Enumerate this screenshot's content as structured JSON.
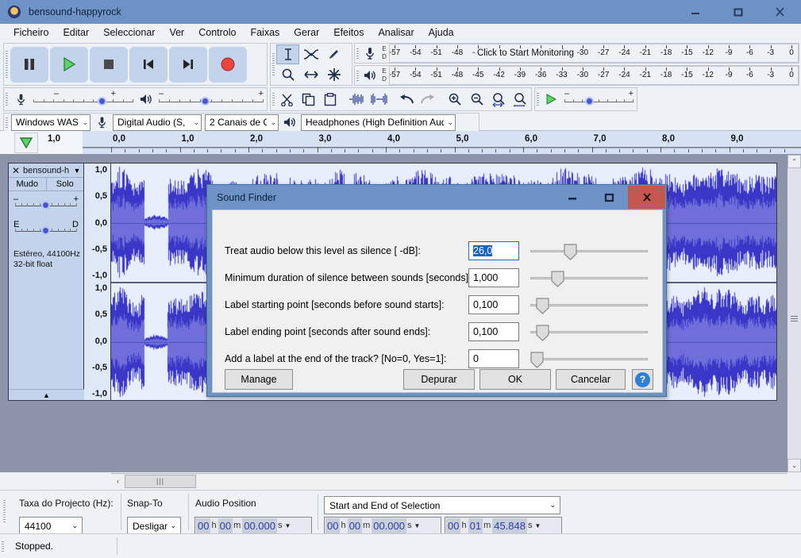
{
  "window": {
    "title": "bensound-happyrock",
    "icon": "audacity-logo-icon",
    "minimize": "–",
    "maximize": "▢",
    "close": "✕"
  },
  "menu": [
    "Ficheiro",
    "Editar",
    "Seleccionar",
    "Ver",
    "Controlo",
    "Faixas",
    "Gerar",
    "Efeitos",
    "Analisar",
    "Ajuda"
  ],
  "transport": [
    {
      "name": "pause-button",
      "icon": "pause-icon"
    },
    {
      "name": "play-button",
      "icon": "play-icon"
    },
    {
      "name": "stop-button",
      "icon": "stop-icon"
    },
    {
      "name": "skip-to-start-button",
      "icon": "skip-start-icon"
    },
    {
      "name": "skip-to-end-button",
      "icon": "skip-end-icon"
    },
    {
      "name": "record-button",
      "icon": "record-icon"
    }
  ],
  "tools": [
    {
      "name": "selection-tool",
      "icon": "i-beam-icon",
      "selected": true
    },
    {
      "name": "envelope-tool",
      "icon": "envelope-icon",
      "selected": false
    },
    {
      "name": "draw-tool",
      "icon": "pencil-icon",
      "selected": false
    },
    {
      "name": "zoom-tool",
      "icon": "magnifier-icon",
      "selected": false
    },
    {
      "name": "timeshift-tool",
      "icon": "arrows-horizontal-icon",
      "selected": false
    },
    {
      "name": "multi-tool",
      "icon": "asterisk-icon",
      "selected": false
    }
  ],
  "meters": {
    "record_hint": "Click to Start Monitoring",
    "ticks": [
      "-57",
      "-54",
      "-51",
      "-48",
      "-45",
      "-42",
      "-39",
      "-36",
      "-33",
      "-30",
      "-27",
      "-24",
      "-21",
      "-18",
      "-15",
      "-12",
      "-9",
      "-6",
      "-3",
      "0"
    ],
    "ed_top": "E",
    "ed_bottom": "D"
  },
  "mixer": {
    "mic_icon": "microphone-icon",
    "speaker_icon": "speaker-icon",
    "minus": "–",
    "plus": "+"
  },
  "edit_toolbar": [
    {
      "name": "cut-button",
      "icon": "scissors-icon"
    },
    {
      "name": "copy-button",
      "icon": "copy-icon"
    },
    {
      "name": "paste-button",
      "icon": "clipboard-icon"
    },
    {
      "name": "trim-audio-button",
      "icon": "trim-outside-icon"
    },
    {
      "name": "silence-audio-button",
      "icon": "silence-selection-icon"
    },
    {
      "name": "undo-button",
      "icon": "undo-arrow-icon"
    },
    {
      "name": "redo-button",
      "icon": "redo-arrow-icon"
    },
    {
      "name": "zoom-in-button",
      "icon": "zoom-in-icon"
    },
    {
      "name": "zoom-out-button",
      "icon": "zoom-out-icon"
    },
    {
      "name": "fit-selection-button",
      "icon": "fit-selection-icon"
    },
    {
      "name": "fit-project-button",
      "icon": "fit-project-icon"
    }
  ],
  "devices": {
    "host": "Windows WAS",
    "recording_device": "Digital Audio (S,",
    "channels": "2 Canais de Gra",
    "playback_device": "Headphones (High Definition Audic",
    "arrow": "⌄"
  },
  "ruler": {
    "pin_icon": "pinned-play-head-icon",
    "left_label": "1,0",
    "labels": [
      "0,0",
      "1,0",
      "2,0",
      "3,0",
      "4,0",
      "5,0",
      "6,0",
      "7,0",
      "8,0",
      "9,0"
    ]
  },
  "track": {
    "close": "✕",
    "name": "bensound-h",
    "dropdown_arrow": "▼",
    "mute": "Mudo",
    "solo": "Solo",
    "gain_minus": "–",
    "gain_plus": "+",
    "pan_left": "E",
    "pan_right": "D",
    "info_line1": "Estéreo, 44100Hz",
    "info_line2": "32-bit float",
    "collapse_icon": "▲",
    "vertical_scale": [
      "1,0",
      "0,5",
      "0,0",
      "-0,5",
      "-1,0"
    ],
    "waveform_peak_color": "#3a37c8",
    "waveform_rms_color": "#6f6edb",
    "waveform_bg_color": "#e8eefb"
  },
  "scrollbars": {
    "up_arrow": "⌃",
    "down_arrow": "⌄",
    "left_arrow": "‹",
    "right_arrow": "›",
    "thumb_grip": "|||"
  },
  "selection_bar": {
    "project_rate_label": "Taxa do Projecto (Hz):",
    "project_rate_value": "44100",
    "snapto_label": "Snap-To",
    "snapto_value": "Desligar",
    "audio_position_label": "Audio Position",
    "selection_mode": "Start and End of Selection",
    "audio_position_time": "00h00m00.000s",
    "selection_start_time": "00h00m00.000s",
    "selection_end_time": "00h01m45.848s",
    "arrow": "⌄"
  },
  "status": {
    "message": "Stopped."
  },
  "dialog": {
    "title": "Sound Finder",
    "minimize": "–",
    "maximize": "▢",
    "close": "✕",
    "fields": [
      {
        "label": "Treat audio below this level as silence [ -dB]:",
        "value": "26,0",
        "selected": true,
        "slider_pct": 32
      },
      {
        "label": "Minimum duration of silence between sounds [seconds]:",
        "value": "1,000",
        "selected": false,
        "slider_pct": 20
      },
      {
        "label": "Label starting point [seconds before sound starts]:",
        "value": "0,100",
        "selected": false,
        "slider_pct": 5
      },
      {
        "label": "Label ending point [seconds after sound ends]:",
        "value": "0,100",
        "selected": false,
        "slider_pct": 5
      },
      {
        "label": "Add a label at the end of the track? [No=0, Yes=1]:",
        "value": "0",
        "selected": false,
        "slider_pct": 0
      }
    ],
    "manage_button": "Manage",
    "debug_button": "Depurar",
    "ok_button": "OK",
    "cancel_button": "Cancelar",
    "help_button": "?"
  }
}
